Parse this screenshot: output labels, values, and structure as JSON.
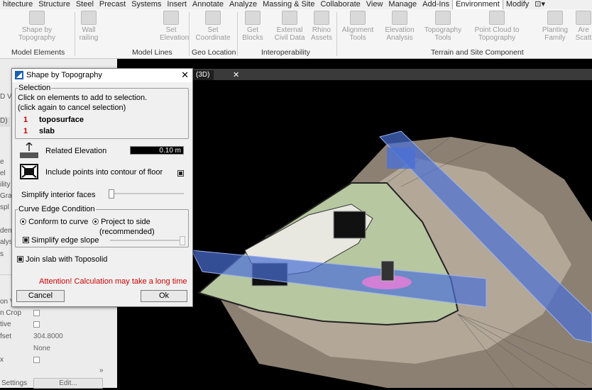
{
  "ribbon_tabs": [
    "hitecture",
    "Structure",
    "Steel",
    "Precast",
    "Systems",
    "Insert",
    "Annotate",
    "Analyze",
    "Massing & Site",
    "Collaborate",
    "View",
    "Manage",
    "Add-Ins",
    "Environment",
    "Modify",
    "⊡▾"
  ],
  "active_tab": "Environment",
  "ribbon_tools": {
    "shape_by_topography": "Shape by Topography",
    "wall_railing": "Wall railing",
    "set_elevation": "Set Elevation",
    "set_coordinate": "Set Coordinate",
    "get_blocks": "Get Blocks",
    "external_civil_data": "External Civil Data",
    "rhino_assets": "Rhino Assets",
    "alignment_tools": "Alignment Tools",
    "elevation_analysis": "Elevation Analysis",
    "topography_tools": "Topography Tools",
    "point_cloud": "Point Cloud to Topography",
    "planting_family": "Planting Family",
    "are_scatter": "Are Scatt"
  },
  "ribbon_panels": {
    "model_elements": "Model Elements",
    "model_lines": "Model Lines",
    "geo_location": "Geo Location",
    "interoperability": "Interoperability",
    "terrain": "Terrain and Site Component"
  },
  "view_tab": "(3D)",
  "left_panel": {
    "frag_3d": "D V",
    "frag_d": "D)",
    "frags": [
      "e",
      "el",
      "ility",
      "Grap",
      "spl"
    ],
    "frags2": [
      "den",
      "alys",
      "s"
    ],
    "props": [
      {
        "k": "on V",
        "v": ""
      },
      {
        "k": "n Crop",
        "v": ""
      },
      {
        "k": "tive",
        "v": ""
      },
      {
        "k": "fset",
        "v": "304.8000"
      },
      {
        "k": "",
        "v": "None"
      },
      {
        "k": "x",
        "v": ""
      }
    ],
    "settings": "Settings",
    "edit_button": "Edit..."
  },
  "dialog": {
    "title": "Shape by Topography",
    "selection_label": "Selection",
    "instruction1": "Click on elements to add to selection.",
    "instruction2": "(click again to cancel selection)",
    "items": [
      {
        "count": "1",
        "name": "toposurface"
      },
      {
        "count": "1",
        "name": "slab"
      }
    ],
    "related_elevation_label": "Related Elevation",
    "related_elevation_value": "0.10 m",
    "include_points_label": "Include points into contour of floor",
    "simplify_interior_label": "Simplify interior faces",
    "curve_edge_label": "Curve Edge Condition",
    "conform_label": "Conform to curve",
    "project_label": "Project to side",
    "recommended_label": "(recommended)",
    "simplify_edge_label": "Simplify edge slope",
    "join_slab_label": "Join slab with Toposolid",
    "attention": "Attention! Calculation may take a long time",
    "cancel": "Cancel",
    "ok": "Ok"
  },
  "colors": {
    "accent": "#cc0000",
    "slab_blue": "#4a6fd6",
    "terrain": "#8a7e70",
    "ribbon_bg": "#f5f5f5"
  }
}
